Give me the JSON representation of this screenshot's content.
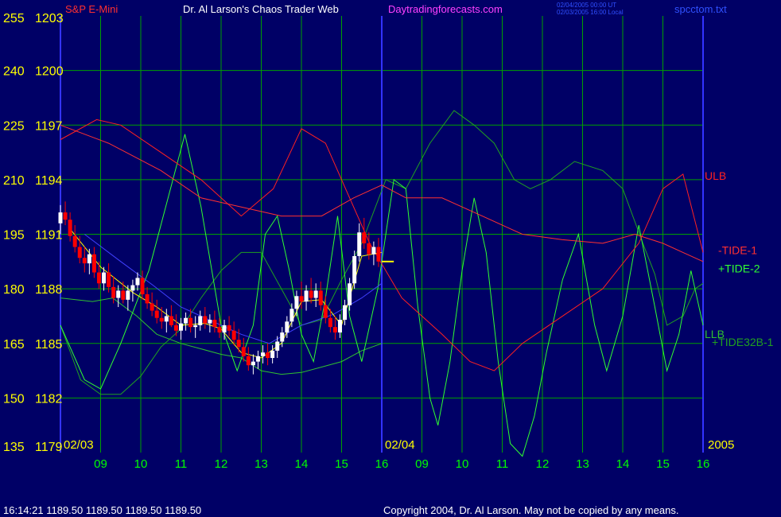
{
  "header": {
    "instrument": "S&P E-Mini",
    "author": "Dr. Al Larson's Chaos Trader Web",
    "site": "Daytradingforecasts.com",
    "time_ut": "02/04/2005 00:00 UT",
    "time_local": "02/03/2005 16:00 Local",
    "file": "spcctom.txt"
  },
  "footer": {
    "status": "16:14:21  1189.50 1189.50 1189.50 1189.50",
    "copyright": "Copyright 2004, Dr. Al Larson. May not be copied by any means."
  },
  "colors": {
    "background": "#000066",
    "grid": "#00a000",
    "price_up": "#ffffff",
    "price_down": "#ff0000",
    "ulb": "#ff2020",
    "tide1": "#ff3030",
    "tide2": "#30ff30",
    "tide32b": "#20a020",
    "llb": "#30c030",
    "ma_fast": "#ffff00",
    "ma_slow": "#4040ff",
    "date_marker": "#3333ff",
    "last_price": "#ffff00"
  },
  "chart_data": {
    "type": "line",
    "left_axis": [
      "255",
      "240",
      "225",
      "210",
      "195",
      "180",
      "165",
      "150",
      "135"
    ],
    "price_axis": [
      "1203",
      "1200",
      "1197",
      "1194",
      "1191",
      "1188",
      "1185",
      "1182",
      "1179"
    ],
    "ylim_price": [
      1179,
      1203
    ],
    "ylim_index": [
      135,
      255
    ],
    "x_hours": [
      "09",
      "10",
      "11",
      "12",
      "13",
      "14",
      "15",
      "16",
      "09",
      "10",
      "11",
      "12",
      "13",
      "14",
      "15",
      "16"
    ],
    "date_labels": [
      {
        "text": "02/03",
        "hour": 8.1
      },
      {
        "text": "02/04",
        "hour": 16.0
      }
    ],
    "year": "2005",
    "xlim_hours": [
      8,
      24
    ],
    "last_price": 1189.5,
    "series_labels": {
      "ulb": "ULB",
      "tide1": "-TIDE-1",
      "tide2": "+TIDE-2",
      "llb": "LLB",
      "tide32b": "+TIDE32B-1"
    },
    "price_bars": [
      [
        8.0,
        1191.6,
        1192.6,
        1191.0,
        1192.2
      ],
      [
        8.12,
        1192.2,
        1192.8,
        1191.5,
        1191.8
      ],
      [
        8.24,
        1191.8,
        1192.2,
        1190.6,
        1190.9
      ],
      [
        8.36,
        1190.9,
        1191.5,
        1190.0,
        1190.3
      ],
      [
        8.48,
        1190.3,
        1190.9,
        1189.4,
        1189.7
      ],
      [
        8.6,
        1189.7,
        1190.3,
        1188.9,
        1189.4
      ],
      [
        8.72,
        1189.4,
        1190.2,
        1188.8,
        1189.9
      ],
      [
        8.84,
        1189.9,
        1190.3,
        1188.6,
        1188.9
      ],
      [
        8.96,
        1188.9,
        1189.5,
        1188.0,
        1188.3
      ],
      [
        9.08,
        1188.3,
        1189.2,
        1187.9,
        1188.9
      ],
      [
        9.2,
        1188.9,
        1189.4,
        1187.8,
        1188.1
      ],
      [
        9.32,
        1188.1,
        1188.7,
        1187.2,
        1187.5
      ],
      [
        9.44,
        1187.5,
        1188.2,
        1187.0,
        1187.9
      ],
      [
        9.56,
        1187.9,
        1188.4,
        1187.2,
        1187.4
      ],
      [
        9.68,
        1187.4,
        1188.2,
        1186.8,
        1187.9
      ],
      [
        9.8,
        1187.9,
        1188.5,
        1187.3,
        1188.2
      ],
      [
        9.92,
        1188.2,
        1188.9,
        1187.9,
        1188.6
      ],
      [
        10.04,
        1188.6,
        1189.0,
        1187.4,
        1187.7
      ],
      [
        10.16,
        1187.7,
        1188.1,
        1186.9,
        1187.2
      ],
      [
        10.28,
        1187.2,
        1187.8,
        1186.5,
        1186.8
      ],
      [
        10.4,
        1186.8,
        1187.4,
        1186.1,
        1186.4
      ],
      [
        10.52,
        1186.4,
        1187.0,
        1185.8,
        1186.2
      ],
      [
        10.64,
        1186.2,
        1186.9,
        1185.6,
        1186.5
      ],
      [
        10.76,
        1186.5,
        1187.1,
        1185.9,
        1186.0
      ],
      [
        10.88,
        1186.0,
        1186.6,
        1185.4,
        1185.7
      ],
      [
        11.0,
        1185.7,
        1186.4,
        1185.2,
        1186.1
      ],
      [
        11.12,
        1186.1,
        1186.7,
        1185.7,
        1186.4
      ],
      [
        11.24,
        1186.4,
        1186.9,
        1185.6,
        1185.9
      ],
      [
        11.36,
        1185.9,
        1186.5,
        1185.3,
        1186.0
      ],
      [
        11.48,
        1186.0,
        1186.8,
        1185.7,
        1186.5
      ],
      [
        11.6,
        1186.5,
        1187.0,
        1185.8,
        1186.1
      ],
      [
        11.72,
        1186.1,
        1186.6,
        1185.6,
        1186.3
      ],
      [
        11.84,
        1186.3,
        1186.8,
        1185.6,
        1185.9
      ],
      [
        11.96,
        1185.9,
        1186.4,
        1185.3,
        1185.6
      ],
      [
        12.08,
        1185.6,
        1186.3,
        1185.2,
        1186.0
      ],
      [
        12.2,
        1186.0,
        1186.5,
        1185.4,
        1185.7
      ],
      [
        12.32,
        1185.7,
        1186.2,
        1184.9,
        1185.2
      ],
      [
        12.44,
        1185.2,
        1185.8,
        1184.5,
        1184.8
      ],
      [
        12.56,
        1184.8,
        1185.3,
        1184.0,
        1184.3
      ],
      [
        12.68,
        1184.3,
        1184.8,
        1183.5,
        1183.8
      ],
      [
        12.8,
        1183.8,
        1184.4,
        1183.3,
        1184.0
      ],
      [
        12.92,
        1184.0,
        1184.6,
        1183.6,
        1184.3
      ],
      [
        13.04,
        1184.3,
        1184.9,
        1183.9,
        1184.5
      ],
      [
        13.16,
        1184.5,
        1185.0,
        1183.8,
        1184.2
      ],
      [
        13.28,
        1184.2,
        1184.9,
        1183.9,
        1184.6
      ],
      [
        13.4,
        1184.6,
        1185.4,
        1184.2,
        1185.1
      ],
      [
        13.52,
        1185.1,
        1185.9,
        1184.8,
        1185.6
      ],
      [
        13.64,
        1185.6,
        1186.5,
        1185.3,
        1186.2
      ],
      [
        13.76,
        1186.2,
        1187.2,
        1185.9,
        1186.9
      ],
      [
        13.88,
        1186.9,
        1187.9,
        1186.5,
        1187.6
      ],
      [
        14.0,
        1187.6,
        1188.4,
        1186.9,
        1187.3
      ],
      [
        14.12,
        1187.3,
        1188.2,
        1186.8,
        1187.9
      ],
      [
        14.24,
        1187.9,
        1188.6,
        1187.2,
        1187.5
      ],
      [
        14.36,
        1187.5,
        1188.3,
        1187.0,
        1187.9
      ],
      [
        14.48,
        1187.9,
        1188.4,
        1186.8,
        1187.1
      ],
      [
        14.6,
        1187.1,
        1187.6,
        1186.1,
        1186.4
      ],
      [
        14.72,
        1186.4,
        1186.9,
        1185.6,
        1185.9
      ],
      [
        14.84,
        1185.9,
        1186.5,
        1185.2,
        1185.6
      ],
      [
        14.96,
        1185.6,
        1186.6,
        1185.3,
        1186.3
      ],
      [
        15.08,
        1186.3,
        1187.4,
        1186.0,
        1187.1
      ],
      [
        15.2,
        1187.1,
        1188.6,
        1186.8,
        1188.3
      ],
      [
        15.32,
        1188.3,
        1190.1,
        1188.0,
        1189.8
      ],
      [
        15.44,
        1189.8,
        1191.6,
        1189.5,
        1191.1
      ],
      [
        15.56,
        1191.1,
        1191.9,
        1190.2,
        1190.5
      ],
      [
        15.68,
        1190.5,
        1191.1,
        1189.6,
        1189.9
      ],
      [
        15.8,
        1189.9,
        1190.6,
        1189.3,
        1190.3
      ],
      [
        15.92,
        1190.3,
        1190.8,
        1189.2,
        1189.5
      ]
    ],
    "ulb": [
      [
        8,
        1196.2
      ],
      [
        8.9,
        1197.3
      ],
      [
        9.5,
        1197.0
      ],
      [
        10.5,
        1195.5
      ],
      [
        11.5,
        1194.0
      ],
      [
        12.5,
        1192.0
      ],
      [
        13.3,
        1193.5
      ],
      [
        14.0,
        1196.8
      ],
      [
        14.6,
        1196.0
      ],
      [
        15.2,
        1193.0
      ],
      [
        15.7,
        1190.5
      ],
      [
        16.5,
        1187.5
      ],
      [
        17.5,
        1185.5
      ],
      [
        18.2,
        1184.0
      ],
      [
        18.8,
        1183.5
      ],
      [
        19.5,
        1185.0
      ],
      [
        20.5,
        1186.5
      ],
      [
        21.5,
        1188.0
      ],
      [
        22.4,
        1190.5
      ],
      [
        23.0,
        1193.5
      ],
      [
        23.5,
        1194.3
      ],
      [
        24.0,
        1190.0
      ]
    ],
    "tide1": [
      [
        8,
        1197.0
      ],
      [
        9.2,
        1196.0
      ],
      [
        10.5,
        1194.5
      ],
      [
        11.5,
        1193.0
      ],
      [
        12.5,
        1192.5
      ],
      [
        13.5,
        1192.0
      ],
      [
        14.5,
        1192.0
      ],
      [
        15.3,
        1193.0
      ],
      [
        16.0,
        1193.7
      ],
      [
        16.6,
        1193.0
      ],
      [
        17.5,
        1193.0
      ],
      [
        18.5,
        1192.0
      ],
      [
        19.5,
        1191.0
      ],
      [
        20.5,
        1190.7
      ],
      [
        21.5,
        1190.5
      ],
      [
        22.3,
        1191.0
      ],
      [
        23.0,
        1190.5
      ],
      [
        23.5,
        1190.0
      ],
      [
        24.0,
        1189.5
      ]
    ],
    "tide2": [
      [
        8,
        1186.0
      ],
      [
        8.6,
        1183.0
      ],
      [
        9.0,
        1182.5
      ],
      [
        9.5,
        1185.0
      ],
      [
        10.2,
        1189.0
      ],
      [
        10.8,
        1194.0
      ],
      [
        11.1,
        1196.5
      ],
      [
        11.5,
        1192.5
      ],
      [
        12.0,
        1186.0
      ],
      [
        12.4,
        1183.5
      ],
      [
        12.8,
        1186.0
      ],
      [
        13.1,
        1191.0
      ],
      [
        13.4,
        1192.0
      ],
      [
        13.7,
        1189.0
      ],
      [
        14.0,
        1185.5
      ],
      [
        14.3,
        1184.0
      ],
      [
        14.6,
        1187.5
      ],
      [
        14.9,
        1192.0
      ],
      [
        15.2,
        1186.5
      ],
      [
        15.5,
        1184.0
      ],
      [
        15.9,
        1188.0
      ],
      [
        16.3,
        1194.0
      ],
      [
        16.6,
        1193.5
      ],
      [
        16.9,
        1187.0
      ],
      [
        17.2,
        1182.0
      ],
      [
        17.4,
        1180.5
      ],
      [
        17.7,
        1184.0
      ],
      [
        18.0,
        1189.0
      ],
      [
        18.3,
        1193.0
      ],
      [
        18.6,
        1190.0
      ],
      [
        18.9,
        1184.0
      ],
      [
        19.2,
        1179.5
      ],
      [
        19.5,
        1178.8
      ],
      [
        19.8,
        1181.0
      ],
      [
        20.1,
        1184.5
      ],
      [
        20.5,
        1188.5
      ],
      [
        20.9,
        1191.0
      ],
      [
        21.3,
        1186.0
      ],
      [
        21.6,
        1183.5
      ],
      [
        22.0,
        1186.5
      ],
      [
        22.4,
        1191.5
      ],
      [
        22.8,
        1187.0
      ],
      [
        23.1,
        1183.5
      ],
      [
        23.4,
        1185.5
      ],
      [
        23.7,
        1189.0
      ],
      [
        24.0,
        1186.0
      ]
    ],
    "tide32b": [
      [
        8,
        1186.0
      ],
      [
        8.5,
        1183.0
      ],
      [
        9.0,
        1182.2
      ],
      [
        9.5,
        1182.2
      ],
      [
        10.0,
        1183.2
      ],
      [
        10.5,
        1184.8
      ],
      [
        11.0,
        1185.8
      ],
      [
        11.5,
        1187.5
      ],
      [
        12.0,
        1189.0
      ],
      [
        12.5,
        1190.0
      ],
      [
        13.0,
        1190.0
      ],
      [
        13.5,
        1188.0
      ],
      [
        14.0,
        1186.0
      ],
      [
        14.5,
        1186.3
      ],
      [
        15.0,
        1188.5
      ],
      [
        15.5,
        1190.5
      ],
      [
        16.1,
        1194.0
      ],
      [
        16.6,
        1193.5
      ],
      [
        17.2,
        1196.0
      ],
      [
        17.8,
        1197.8
      ],
      [
        18.3,
        1197.0
      ],
      [
        18.8,
        1196.0
      ],
      [
        19.3,
        1194.0
      ],
      [
        19.7,
        1193.5
      ],
      [
        20.2,
        1194.0
      ],
      [
        20.8,
        1195.0
      ],
      [
        21.5,
        1194.5
      ],
      [
        22.0,
        1193.5
      ],
      [
        22.5,
        1190.5
      ],
      [
        22.8,
        1188.8
      ],
      [
        23.1,
        1186.0
      ],
      [
        23.5,
        1186.5
      ],
      [
        23.8,
        1188.0
      ],
      [
        24.0,
        1188.3
      ]
    ],
    "llb": [
      [
        8,
        1187.5
      ],
      [
        8.8,
        1187.3
      ],
      [
        9.3,
        1187.5
      ],
      [
        9.9,
        1186.5
      ],
      [
        10.4,
        1185.5
      ],
      [
        11.0,
        1185.0
      ],
      [
        11.5,
        1184.7
      ],
      [
        12.0,
        1184.4
      ],
      [
        12.5,
        1184.2
      ],
      [
        13.0,
        1183.5
      ],
      [
        13.5,
        1183.3
      ],
      [
        14.0,
        1183.4
      ],
      [
        14.5,
        1183.7
      ],
      [
        15.0,
        1184.0
      ],
      [
        15.5,
        1184.6
      ],
      [
        16.0,
        1185.0
      ]
    ],
    "ma_fast": [
      [
        8.2,
        1191.4
      ],
      [
        9.0,
        1189.2
      ],
      [
        9.8,
        1187.8
      ],
      [
        10.4,
        1187.0
      ],
      [
        11.0,
        1186.0
      ],
      [
        11.6,
        1186.1
      ],
      [
        12.0,
        1185.8
      ],
      [
        12.5,
        1184.5
      ],
      [
        13.0,
        1184.2
      ],
      [
        13.5,
        1185.0
      ],
      [
        14.0,
        1187.3
      ],
      [
        14.5,
        1187.4
      ],
      [
        15.0,
        1186.0
      ],
      [
        15.5,
        1189.8
      ],
      [
        16.0,
        1190.0
      ]
    ],
    "ma_slow": [
      [
        8.6,
        1191.0
      ],
      [
        9.5,
        1189.5
      ],
      [
        10.3,
        1188.2
      ],
      [
        11.0,
        1187.0
      ],
      [
        11.8,
        1186.2
      ],
      [
        12.5,
        1185.5
      ],
      [
        13.2,
        1185.0
      ],
      [
        14.0,
        1186.0
      ],
      [
        14.8,
        1186.6
      ],
      [
        15.5,
        1187.5
      ],
      [
        16.0,
        1188.3
      ]
    ]
  }
}
